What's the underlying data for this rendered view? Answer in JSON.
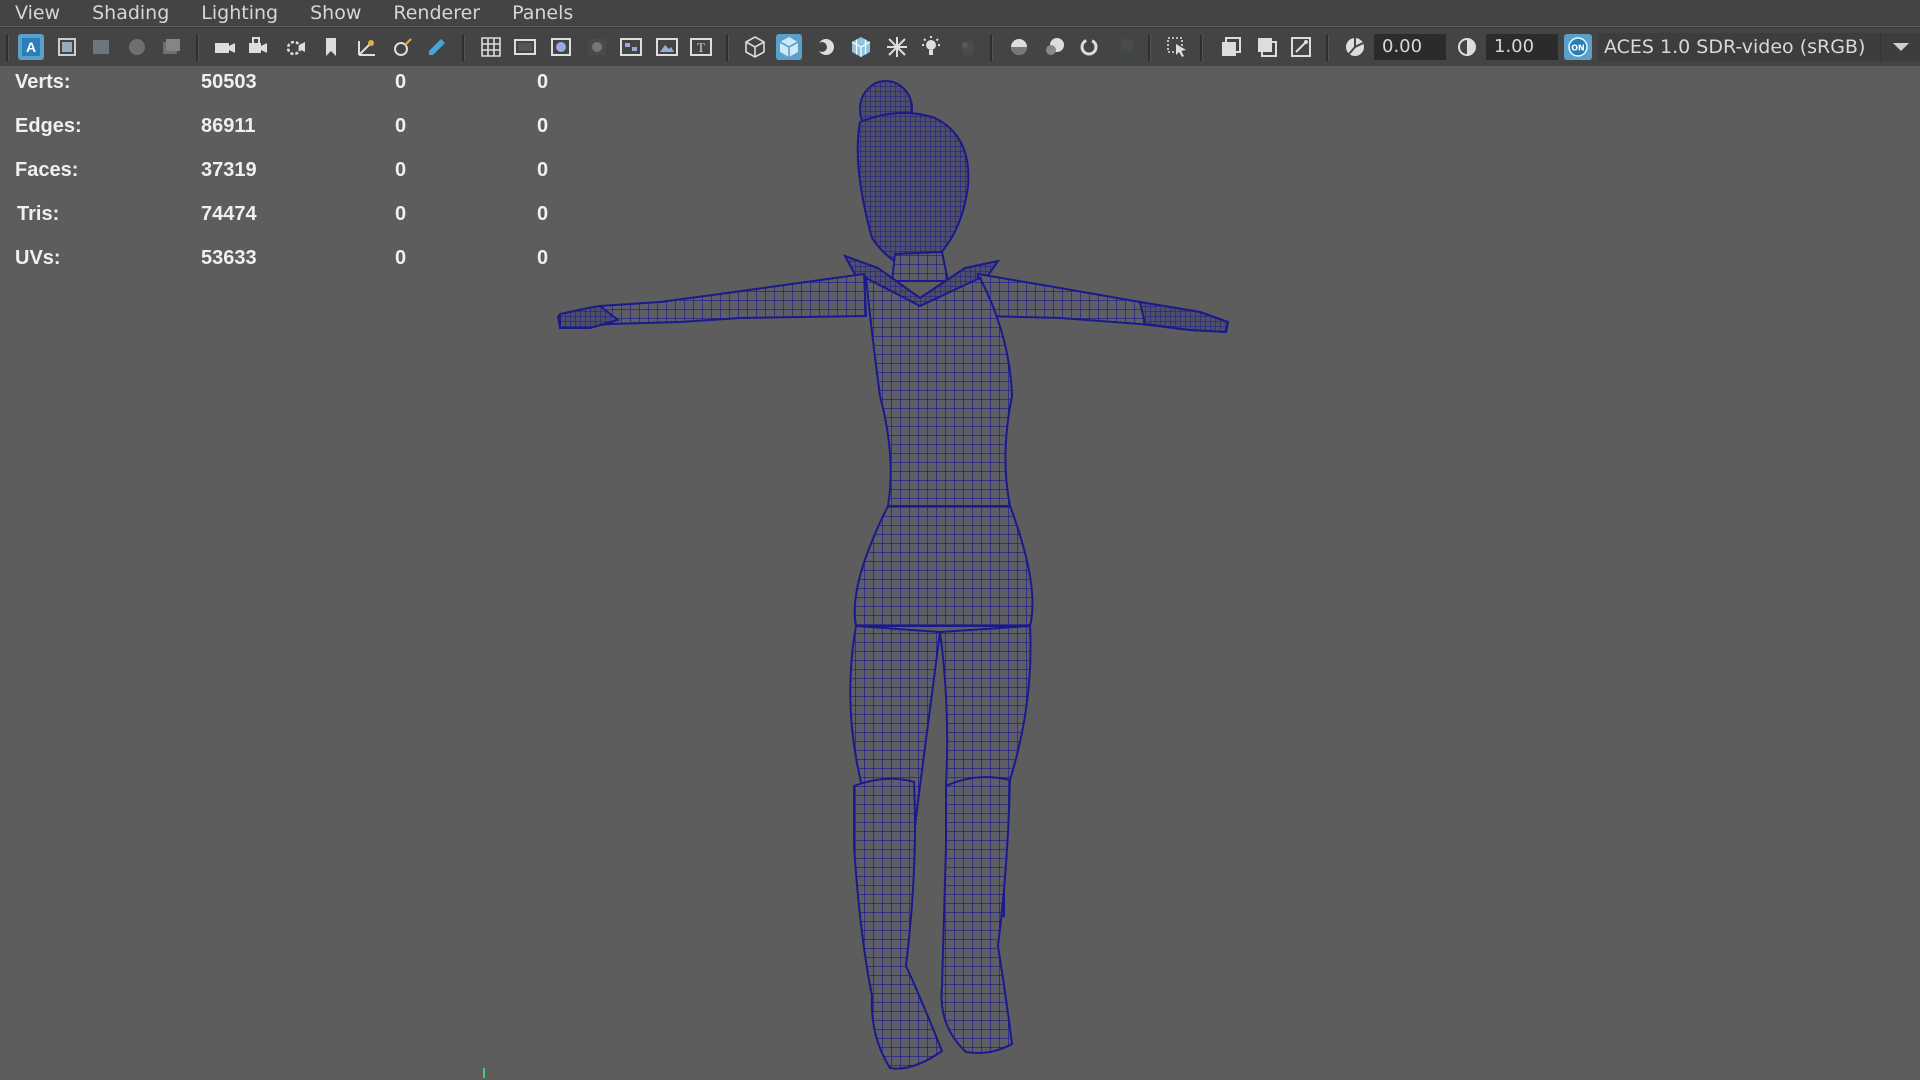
{
  "menubar": {
    "items": [
      "View",
      "Shading",
      "Lighting",
      "Show",
      "Renderer",
      "Panels"
    ]
  },
  "toolbar": {
    "exposure_value": "0.00",
    "gamma_value": "1.00",
    "colorspace_value": "ACES 1.0 SDR-video (sRGB)",
    "colors": {
      "accent": "#5aa0c8",
      "background": "#444444"
    }
  },
  "hud": {
    "rows": [
      {
        "label": "Verts:",
        "v1": "50503",
        "v2": "0",
        "v3": "0"
      },
      {
        "label": "Edges:",
        "v1": "86911",
        "v2": "0",
        "v3": "0"
      },
      {
        "label": "Faces:",
        "v1": "37319",
        "v2": "0",
        "v3": "0"
      },
      {
        "label": "Tris:",
        "v1": "74474",
        "v2": "0",
        "v3": "0"
      },
      {
        "label": "UVs:",
        "v1": "53633",
        "v2": "0",
        "v3": "0"
      }
    ]
  },
  "viewport": {
    "background": "#5d5d5d",
    "wireframe_color": "#1a1a8c"
  }
}
